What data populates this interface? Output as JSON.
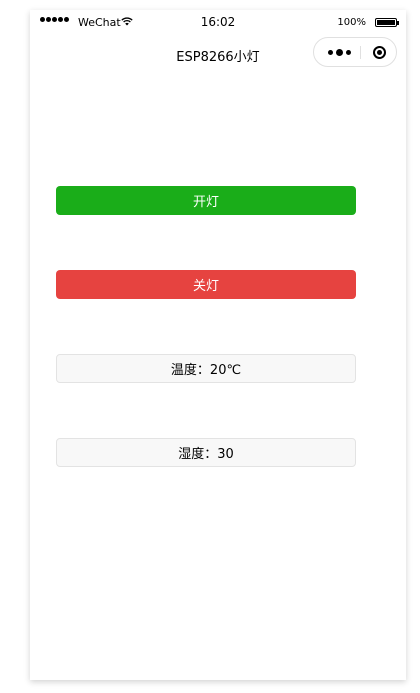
{
  "status_bar": {
    "carrier": "WeChat",
    "time": "16:02",
    "battery": "100%"
  },
  "nav": {
    "title": "ESP8266小灯"
  },
  "buttons": {
    "on_label": "开灯",
    "off_label": "关灯",
    "temperature": "温度：20℃",
    "humidity": "湿度：30"
  },
  "colors": {
    "on": "#1aad19",
    "off": "#e64340"
  },
  "icons": {
    "signal": "signal-dots-icon",
    "wifi": "wifi-icon",
    "battery": "battery-icon",
    "more": "more-dots-icon",
    "close": "close-target-icon"
  }
}
